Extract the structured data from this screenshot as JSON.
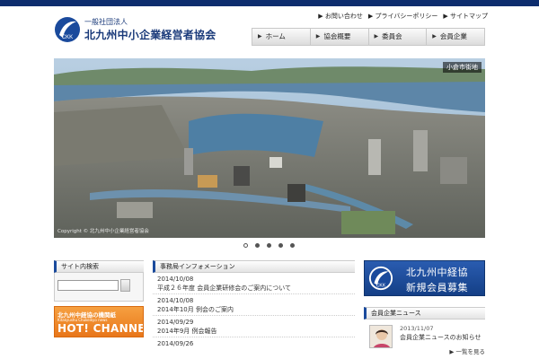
{
  "header": {
    "logo_sub": "一般社団法人",
    "logo_main": "北九州中小企業経営者協会",
    "logo_mark_text": "CKK",
    "top_links": [
      {
        "label": "お問い合わせ"
      },
      {
        "label": "プライバシーポリシー"
      },
      {
        "label": "サイトマップ"
      }
    ]
  },
  "nav": {
    "items": [
      {
        "label": "ホーム"
      },
      {
        "label": "協会概要"
      },
      {
        "label": "委員会"
      },
      {
        "label": "会員企業"
      }
    ]
  },
  "hero": {
    "caption": "小倉市街地",
    "copyright": "Copyright © 北九州中小企業経営者協会",
    "slide_count": 5,
    "active_slide": 1
  },
  "sidebar": {
    "search_heading": "サイト内検索",
    "search_value": "",
    "banner_line1": "北九州中経協の機関紙",
    "banner_line2": "Kitakyushu Chukeikyo news",
    "banner_line3": "HOT! CHANNEL"
  },
  "news": {
    "heading": "事務局インフォメーション",
    "items": [
      {
        "date": "2014/10/08",
        "title": "平成２６年度 会員企業研修会のご案内について"
      },
      {
        "date": "2014/10/08",
        "title": "2014年10月 例会のご案内"
      },
      {
        "date": "2014/09/29",
        "title": "2014年9月 例会報告"
      },
      {
        "date": "2014/09/26",
        "title": ""
      }
    ]
  },
  "right": {
    "recruit_line1": "北九州中経協",
    "recruit_line2": "新規会員募集",
    "recruit_mark_text": "CKK",
    "member_heading": "会員企業ニュース",
    "member_date": "2013/11/07",
    "member_title": "会員企業ニュースのお知らせ",
    "more_label": "一覧を見る"
  },
  "colors": {
    "brand_navy": "#0d2d6e",
    "brand_blue": "#1a4a9c",
    "banner_orange": "#e8761a"
  }
}
